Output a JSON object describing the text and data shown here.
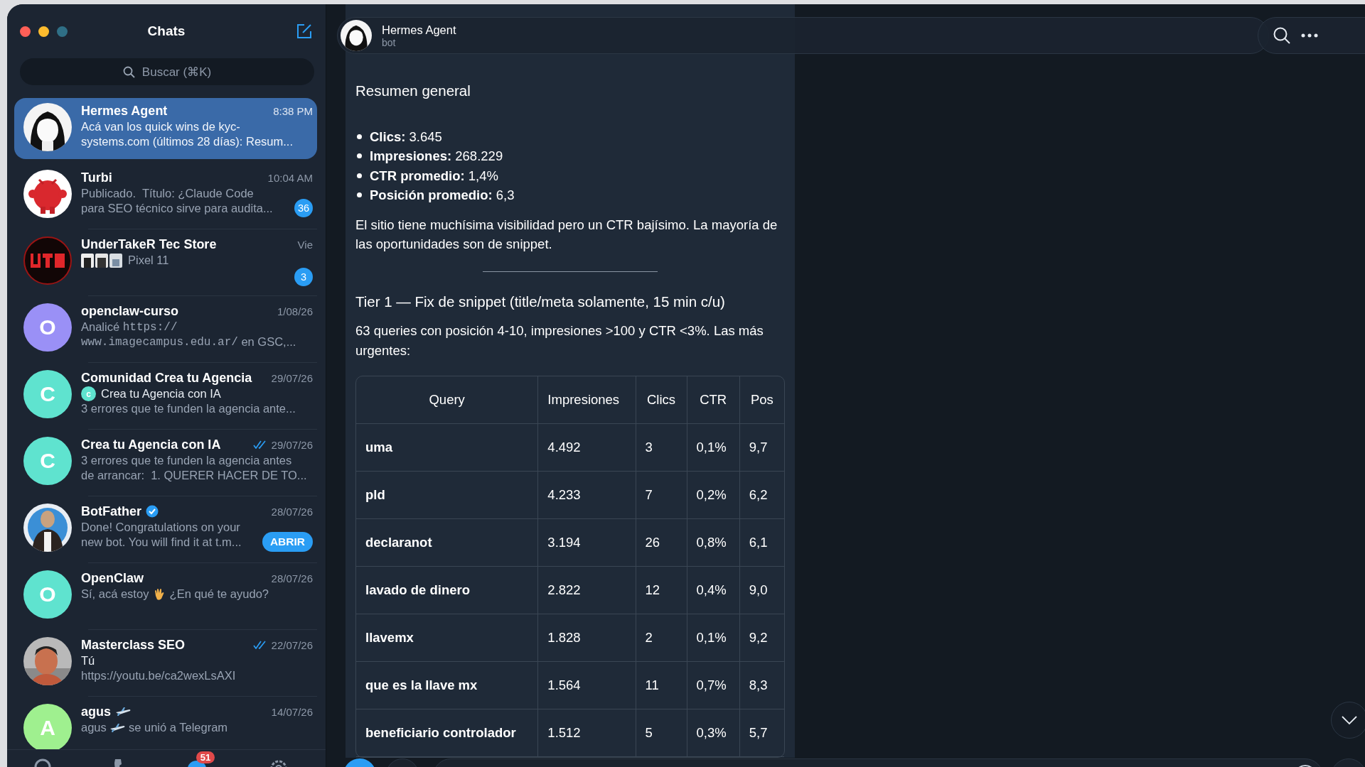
{
  "sidebar": {
    "title": "Chats",
    "search": {
      "placeholder": "Buscar (⌘K)"
    },
    "chats": [
      {
        "name": "Hermes Agent",
        "time": "8:38 PM",
        "selected": true,
        "ticks": false,
        "verified": false,
        "avatar": {
          "kind": "picture"
        },
        "lines": [
          [
            {
              "text": "Acá van los quick wins de kyc-"
            }
          ],
          [
            {
              "text": "systems.com (últimos 28 días): Resum..."
            }
          ]
        ]
      },
      {
        "name": "Turbi",
        "time": "10:04 AM",
        "selected": false,
        "ticks": false,
        "verified": false,
        "avatar": {
          "kind": "picture"
        },
        "unread": "36",
        "lines": [
          [
            {
              "text": "Publicado.  Título: ¿Claude Code"
            }
          ],
          [
            {
              "text": "para SEO técnico sirve para audita..."
            }
          ]
        ]
      },
      {
        "name": "UnderTakeR Tec Store",
        "time": "Vie",
        "selected": false,
        "ticks": false,
        "verified": false,
        "avatar": {
          "kind": "picture"
        },
        "unread": "3",
        "lines": [
          [
            {
              "kind": "thumbs"
            },
            {
              "text": "Pixel 11"
            }
          ]
        ]
      },
      {
        "name": "openclaw-curso",
        "time": "1/08/26",
        "selected": false,
        "ticks": false,
        "verified": false,
        "avatar": {
          "kind": "letter",
          "letter": "O",
          "color": "#9a90f6"
        },
        "lines": [
          [
            {
              "text": "Analicé "
            },
            {
              "text": "https://",
              "mono": true
            }
          ],
          [
            {
              "text": "www.imagecampus.edu.ar/",
              "mono": true
            },
            {
              "text": " en GSC,..."
            }
          ]
        ]
      },
      {
        "name": "Comunidad Crea tu Agencia",
        "time": "29/07/26",
        "selected": false,
        "ticks": false,
        "verified": false,
        "avatar": {
          "kind": "letter",
          "letter": "C",
          "color": "#5fe3cf"
        },
        "lines": [
          [
            {
              "kind": "sender",
              "letter": "c",
              "color": "#5fe3cf"
            },
            {
              "text": "Crea tu Agencia con IA",
              "strong": true
            }
          ],
          [
            {
              "text": "3 errores que te funden la agencia ante..."
            }
          ]
        ]
      },
      {
        "name": "Crea tu Agencia con IA",
        "time": "29/07/26",
        "selected": false,
        "ticks": true,
        "verified": false,
        "avatar": {
          "kind": "letter",
          "letter": "C",
          "color": "#5fe3cf"
        },
        "lines": [
          [
            {
              "text": "3 errores que te funden la agencia antes"
            }
          ],
          [
            {
              "text": "de arrancar:  1. QUERER HACER DE TO..."
            }
          ]
        ]
      },
      {
        "name": "BotFather",
        "time": "28/07/26",
        "selected": false,
        "ticks": false,
        "verified": true,
        "avatar": {
          "kind": "picture"
        },
        "button": "ABRIR",
        "lines": [
          [
            {
              "text": "Done! Congratulations on your"
            }
          ],
          [
            {
              "text": "new bot. You will find it at t.m..."
            }
          ]
        ]
      },
      {
        "name": "OpenClaw",
        "time": "28/07/26",
        "selected": false,
        "ticks": false,
        "verified": false,
        "avatar": {
          "kind": "letter",
          "letter": "O",
          "color": "#5fe3cf"
        },
        "lines": [
          [
            {
              "text": "Sí, acá estoy "
            },
            {
              "kind": "wave"
            },
            {
              "text": " ¿En qué te ayudo?"
            }
          ]
        ]
      },
      {
        "name": "Masterclass SEO",
        "time": "22/07/26",
        "selected": false,
        "ticks": true,
        "verified": false,
        "avatar": {
          "kind": "picture"
        },
        "lines": [
          [
            {
              "text": "Tú",
              "strong": true
            }
          ],
          [
            {
              "text": "https://youtu.be/ca2wexLsAXI"
            }
          ]
        ]
      },
      {
        "name": "agus",
        "name_emoji": true,
        "time": "14/07/26",
        "selected": false,
        "ticks": false,
        "verified": false,
        "avatar": {
          "kind": "letter",
          "letter": "A",
          "color": "#9ff08f"
        },
        "lines": [
          [
            {
              "text": "agus "
            },
            {
              "kind": "plane"
            },
            {
              "text": " se unió a Telegram"
            }
          ]
        ]
      }
    ],
    "tabs": [
      {
        "kind": "contacts",
        "selected": false
      },
      {
        "kind": "calls",
        "selected": false
      },
      {
        "kind": "chats",
        "selected": true,
        "badge": "51"
      },
      {
        "kind": "settings",
        "selected": false
      }
    ]
  },
  "chat": {
    "title": "Hermes Agent",
    "subtitle": "bot",
    "message": {
      "heading": "Resumen general",
      "bullets": [
        "**Clics:** 3.645",
        "**Impresiones:** 268.229",
        "**CTR promedio:** 1,4%",
        "**Posición promedio:** 6,3"
      ],
      "paragraph": "El sitio tiene muchísima visibilidad pero un CTR bajísimo. La mayoría de las oportunidades son de snippet.",
      "heading_2": "Tier 1 — Fix de snippet (title/meta solamente, 15 min c/u)",
      "paragraph_2": "63 queries con posición 4-10, impresiones >100 y CTR <3%. Las más urgentes:",
      "table": {
        "columns": [
          "Query",
          "Impresiones",
          "Clics",
          "CTR",
          "Pos"
        ],
        "rows": [
          [
            "uma",
            "4.492",
            "3",
            "0,1%",
            "9,7"
          ],
          [
            "pld",
            "4.233",
            "7",
            "0,2%",
            "6,2"
          ],
          [
            "declaranot",
            "3.194",
            "26",
            "0,8%",
            "6,1"
          ],
          [
            "lavado de dinero",
            "2.822",
            "12",
            "0,4%",
            "9,0"
          ],
          [
            "llavemx",
            "1.828",
            "2",
            "0,1%",
            "9,2"
          ],
          [
            "que es la llave mx",
            "1.564",
            "11",
            "0,7%",
            "8,3"
          ],
          [
            "beneficiario controlador",
            "1.512",
            "5",
            "0,3%",
            "5,7"
          ]
        ]
      }
    }
  }
}
